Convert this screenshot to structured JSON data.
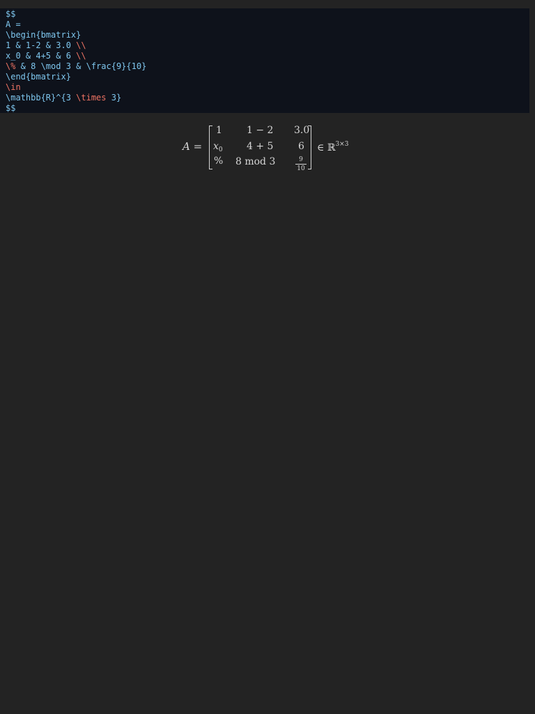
{
  "editor": {
    "source_lines": [
      [
        {
          "t": "$$",
          "k": "plain"
        }
      ],
      [
        {
          "t": "A =",
          "k": "plain"
        }
      ],
      [
        {
          "t": "\\begin{bmatrix}",
          "k": "plain"
        }
      ],
      [
        {
          "t": "1 & 1-2 & 3.0 ",
          "k": "plain"
        },
        {
          "t": "\\\\",
          "k": "kw"
        }
      ],
      [
        {
          "t": "x_0 & 4+5 & 6 ",
          "k": "plain"
        },
        {
          "t": "\\\\",
          "k": "kw"
        }
      ],
      [
        {
          "t": "\\%",
          "k": "kw"
        },
        {
          "t": " & 8 \\mod 3 & \\frac{9}{10}",
          "k": "plain"
        }
      ],
      [
        {
          "t": "\\end{bmatrix}",
          "k": "plain"
        }
      ],
      [
        {
          "t": "\\in",
          "k": "kw"
        }
      ],
      [
        {
          "t": "\\mathbb{R}^{3 ",
          "k": "plain"
        },
        {
          "t": "\\times",
          "k": "kw"
        },
        {
          "t": " 3}",
          "k": "plain"
        }
      ],
      [
        {
          "t": "$$",
          "k": "plain"
        }
      ]
    ],
    "colors": {
      "plain": "#7ec6ee",
      "kw": "#ef7363",
      "background": "#0e121b"
    }
  },
  "rendered": {
    "lhs_var": "A",
    "lhs_eq": " =",
    "matrix": {
      "r0c0": "1",
      "r0c1": "1 − 2",
      "r0c2": "3.0",
      "r1c0_base": "x",
      "r1c0_sub": "0",
      "r1c1": "4 + 5",
      "r1c2": "6",
      "r2c0": "%",
      "r2c1": "8  mod  3",
      "r2c2_num": "9",
      "r2c2_den": "10"
    },
    "rhs_in": "∈ ℝ",
    "rhs_sup": "3×3"
  },
  "page_background": "#232323"
}
